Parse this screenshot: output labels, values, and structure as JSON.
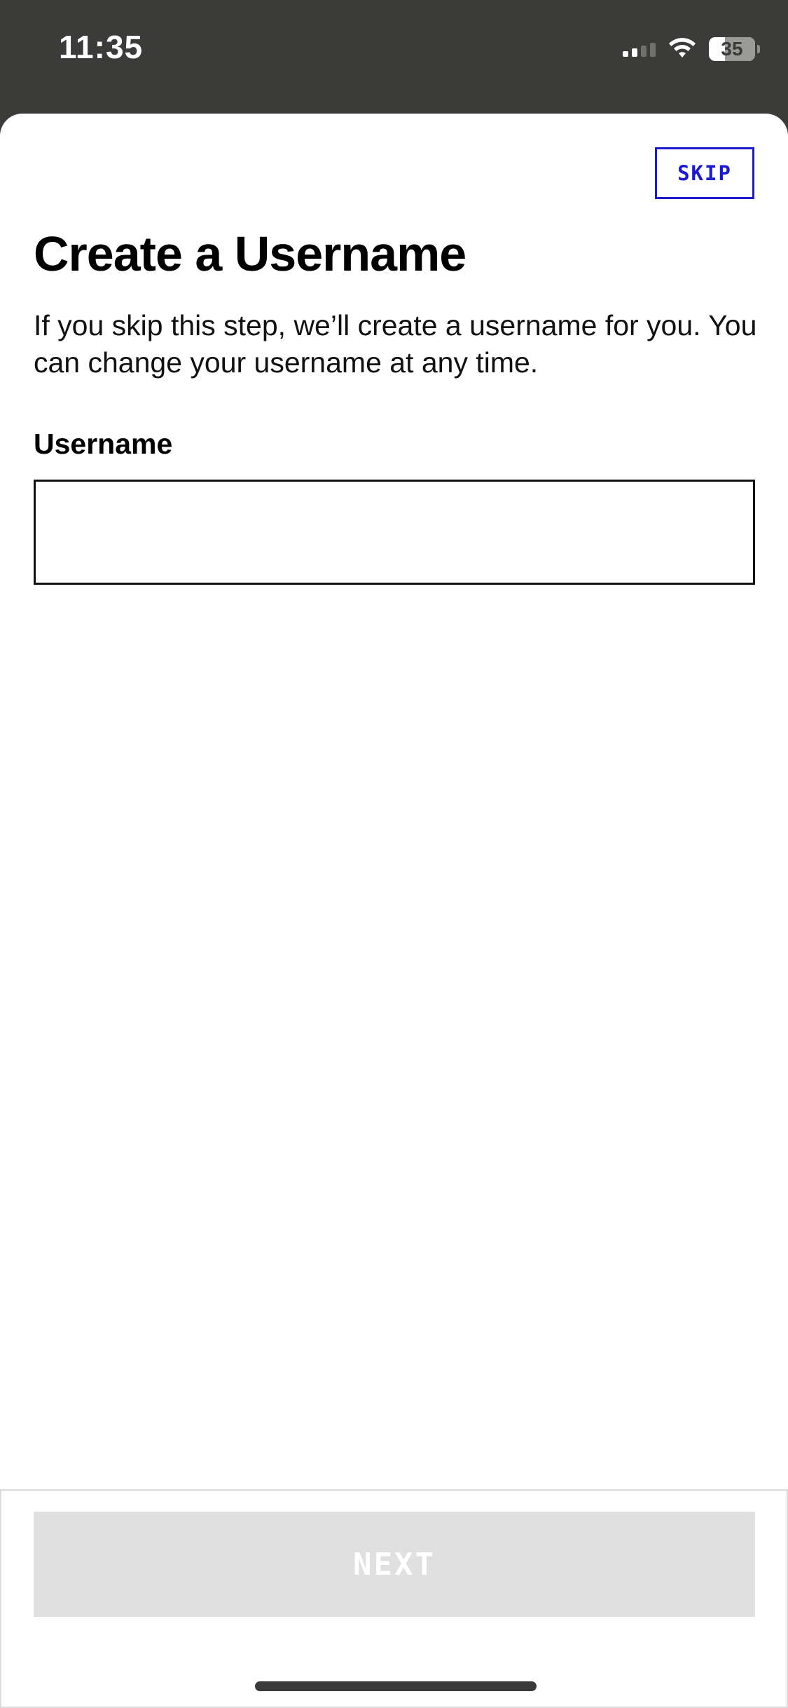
{
  "status_bar": {
    "time": "11:35",
    "battery_level": "35",
    "signal_bars_active": 2,
    "signal_bars_total": 4,
    "wifi_icon": "wifi-icon",
    "battery_icon": "battery-icon"
  },
  "header": {
    "skip_label": "SKIP"
  },
  "main": {
    "title": "Create a Username",
    "description": "If you skip this step, we’ll create a username for you. You can change your username at any time.",
    "username_label": "Username",
    "username_value": "",
    "username_placeholder": ""
  },
  "footer": {
    "next_label": "NEXT",
    "next_enabled": false
  },
  "colors": {
    "accent": "#1c1ad1",
    "status_bar_bg": "#3b3c3a",
    "disabled_button_bg": "#e0e0e0"
  }
}
